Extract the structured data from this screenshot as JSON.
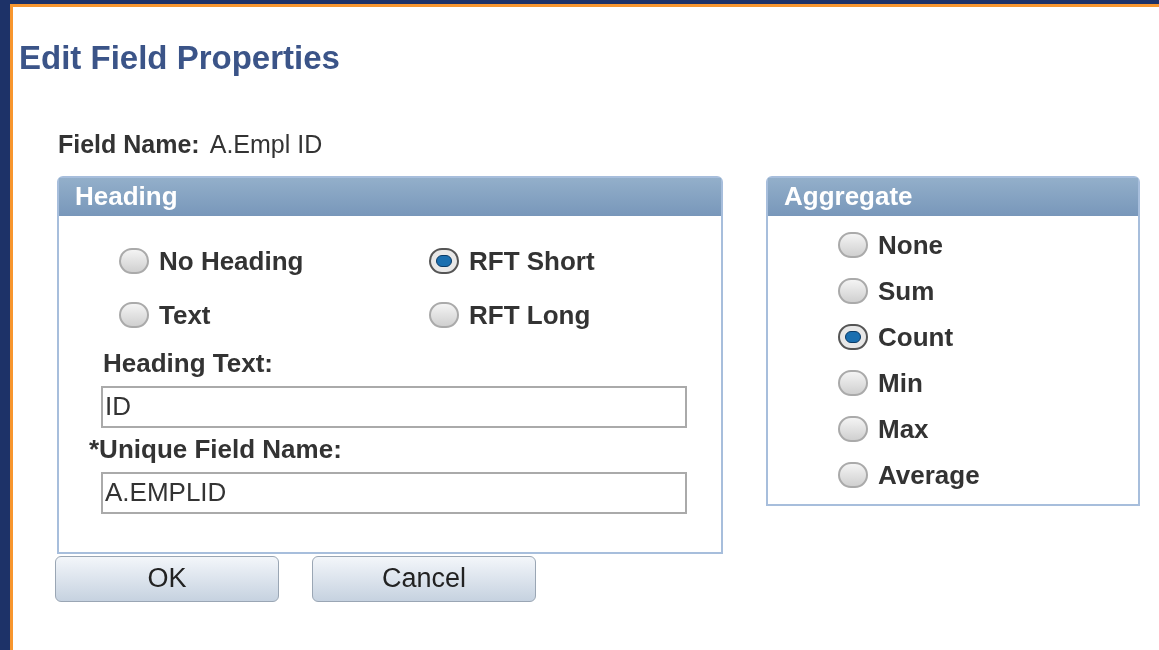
{
  "title": "Edit Field Properties",
  "field_name": {
    "label": "Field Name:",
    "value": "A.Empl ID"
  },
  "heading": {
    "title": "Heading",
    "options": [
      {
        "label": "No Heading",
        "selected": false
      },
      {
        "label": "RFT Short",
        "selected": true
      },
      {
        "label": "Text",
        "selected": false
      },
      {
        "label": "RFT Long",
        "selected": false
      }
    ],
    "fields": [
      {
        "label": "Heading Text:",
        "value": "ID"
      },
      {
        "label": "*Unique Field Name:",
        "value": "A.EMPLID"
      }
    ]
  },
  "aggregate": {
    "title": "Aggregate",
    "options": [
      {
        "label": "None",
        "selected": false
      },
      {
        "label": "Sum",
        "selected": false
      },
      {
        "label": "Count",
        "selected": true
      },
      {
        "label": "Min",
        "selected": false
      },
      {
        "label": "Max",
        "selected": false
      },
      {
        "label": "Average",
        "selected": false
      }
    ]
  },
  "buttons": [
    "OK",
    "Cancel"
  ]
}
